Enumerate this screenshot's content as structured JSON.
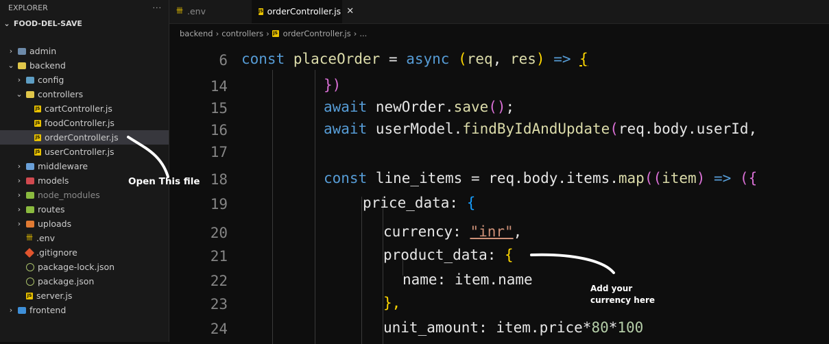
{
  "sidebar": {
    "title": "EXPLORER",
    "more": "···",
    "project": "FOOD-DEL-SAVE",
    "items": [
      {
        "label": "admin",
        "chev": "›",
        "icon": "folder"
      },
      {
        "label": "backend",
        "chev": "⌄",
        "icon": "folder"
      },
      {
        "label": "config",
        "chev": "›",
        "icon": "folder"
      },
      {
        "label": "controllers",
        "chev": "⌄",
        "icon": "folder"
      },
      {
        "label": "cartController.js",
        "chev": "",
        "icon": "js"
      },
      {
        "label": "foodController.js",
        "chev": "",
        "icon": "js"
      },
      {
        "label": "orderController.js",
        "chev": "",
        "icon": "js"
      },
      {
        "label": "userController.js",
        "chev": "",
        "icon": "js"
      },
      {
        "label": "middleware",
        "chev": "›",
        "icon": "folder"
      },
      {
        "label": "models",
        "chev": "›",
        "icon": "folder"
      },
      {
        "label": "node_modules",
        "chev": "›",
        "icon": "folder"
      },
      {
        "label": "routes",
        "chev": "›",
        "icon": "folder"
      },
      {
        "label": "uploads",
        "chev": "›",
        "icon": "folder"
      },
      {
        "label": ".env",
        "chev": "",
        "icon": "env"
      },
      {
        "label": ".gitignore",
        "chev": "",
        "icon": "git"
      },
      {
        "label": "package-lock.json",
        "chev": "",
        "icon": "json"
      },
      {
        "label": "package.json",
        "chev": "",
        "icon": "json"
      },
      {
        "label": "server.js",
        "chev": "",
        "icon": "js"
      },
      {
        "label": "frontend",
        "chev": "›",
        "icon": "folder"
      }
    ]
  },
  "tabs": [
    {
      "label": ".env",
      "icon": "env"
    },
    {
      "label": "orderController.js",
      "icon": "js",
      "close": "✕"
    }
  ],
  "breadcrumb": [
    "backend",
    "controllers",
    "orderController.js",
    "..."
  ],
  "icon_text": {
    "js": "JS",
    "env": "卌"
  },
  "code": {
    "line_numbers": [
      "6",
      "14",
      "15",
      "16",
      "17",
      "18",
      "19",
      "20",
      "21",
      "22",
      "23",
      "24"
    ],
    "l6": {
      "a": "const ",
      "b": "placeOrder",
      "c": " = ",
      "d": "async ",
      "e": "(",
      "f": "req",
      "g": ", ",
      "h": "res",
      "i": ") ",
      "j": "=> ",
      "k": "{"
    },
    "l14": {
      "a": "})"
    },
    "l15": {
      "a": "await ",
      "b": "newOrder",
      "c": ".",
      "d": "save",
      "e": "()",
      "f": ";"
    },
    "l16": {
      "a": "await ",
      "b": "userModel",
      "c": ".",
      "d": "findByIdAndUpdate",
      "e": "(",
      "f": "req.body.userId,"
    },
    "l18": {
      "a": "const ",
      "b": "line_items",
      "c": " = req.body.items.",
      "d": "map",
      "e": "((",
      "f": "item",
      "g": ") ",
      "h": "=> ",
      "i": "({"
    },
    "l19": {
      "a": "price_data: ",
      "b": "{"
    },
    "l20": {
      "a": "currency: ",
      "b": "\"inr\"",
      "c": ","
    },
    "l21": {
      "a": "product_data: ",
      "b": "{"
    },
    "l22": {
      "a": "name: item.name"
    },
    "l23": {
      "a": "},"
    },
    "l24": {
      "a": "unit_amount: item.price*",
      "b": "80",
      "c": "*",
      "d": "100"
    }
  },
  "annotations": {
    "open_file": "Open This file",
    "currency_line1": "Add your",
    "currency_line2": "currency here"
  }
}
